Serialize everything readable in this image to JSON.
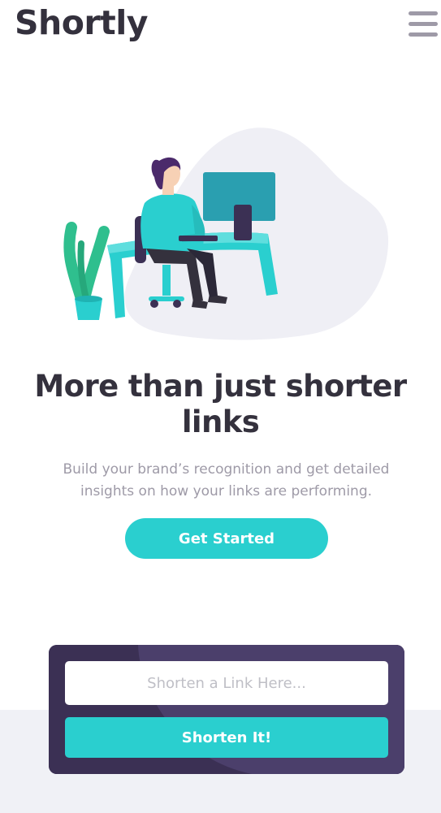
{
  "header": {
    "logo": "Shortly",
    "menu_icon": "hamburger-menu-icon"
  },
  "hero": {
    "illustration": "person-working-at-desk-illustration",
    "headline": "More than just shorter links",
    "subtext": "Build your brand’s recognition and get detailed insights on how your links are performing.",
    "cta_label": "Get Started"
  },
  "shorten": {
    "input_value": "",
    "input_placeholder": "Shorten a Link Here...",
    "button_label": "Shorten It!"
  },
  "colors": {
    "primary_cyan": "#2acfcf",
    "dark_violet": "#3b3054",
    "very_dark_text": "#34313d",
    "gray_text": "#9e9aa7",
    "light_bg": "#f0f1f6"
  }
}
